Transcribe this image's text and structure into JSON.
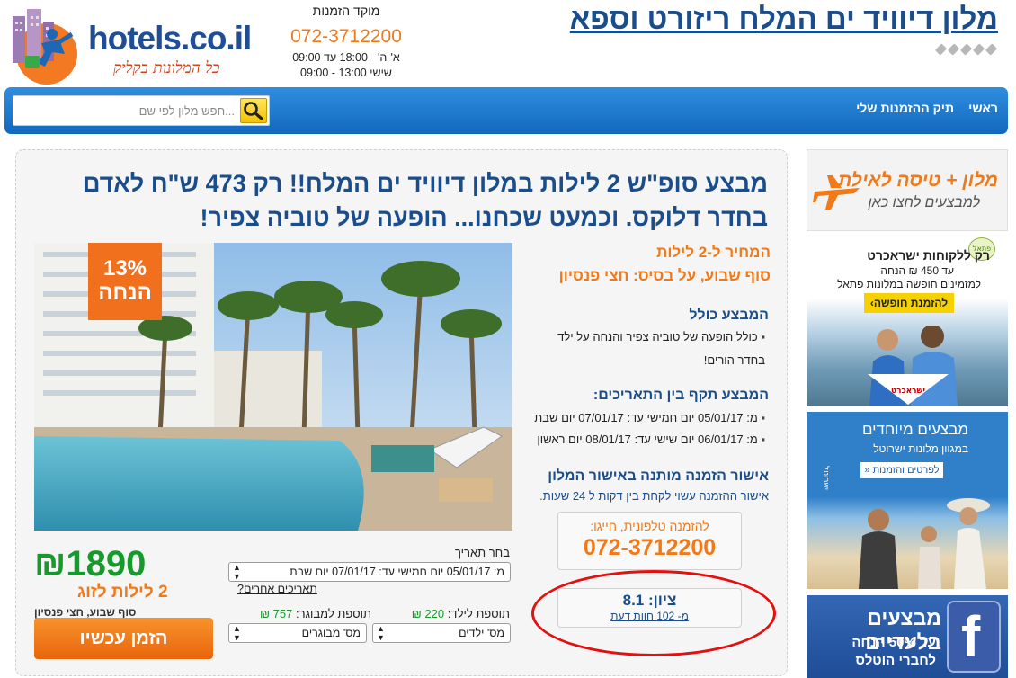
{
  "header": {
    "logo_text": "hotels.co.il",
    "logo_tagline": "כל המלונות בקליק",
    "call_center_title": "מוקד הזמנות",
    "call_center_phone": "072-3712200",
    "hours_weekdays": "א'-ה' - 18:00 עד 09:00",
    "hours_friday": "שישי 13:00 - 09:00",
    "hotel_title": "מלון דיוויד ים המלח ריזורט וספא",
    "star_count": 5
  },
  "nav": {
    "home": "ראשי",
    "my_bookings": "תיק ההזמנות שלי",
    "search_placeholder": "...חפש מלון לפי שם"
  },
  "deal": {
    "title": "מבצע סופ\"ש 2 לילות במלון דיוויד ים המלח!! רק 473 ש\"ח לאדם בחדר דלוקס. וכמעט שכחנו... הופעה של טוביה צפיר!",
    "discount_percent": "13%",
    "discount_word": "הנחה",
    "price_nights": "המחיר ל-2 לילות",
    "price_basis": "סוף שבוע, על בסיס: חצי פנסיון",
    "includes_heading": "המבצע כולל",
    "includes_items": [
      "כולל הופעה של טוביה צפיר והנחה על ילד בחדר הורים!"
    ],
    "valid_heading": "המבצע תקף בין התאריכים:",
    "valid_items": [
      "מ: 05/01/17 יום חמישי עד: 07/01/17 יום שבת",
      "מ: 06/01/17 יום שישי עד: 08/01/17 יום ראשון"
    ],
    "approval_heading": "אישור הזמנה מותנה באישור המלון",
    "approval_text": "אישור ההזמנה עשוי לקחת בין דקות ל 24 שעות.",
    "phone_label": "להזמנה טלפונית, חייגו:",
    "phone_number": "072-3712200",
    "score_label": "ציון: 8.1",
    "score_reviews": "מ- 102 חוות דעת",
    "price": "1890",
    "currency": "₪",
    "price_couple": "2 לילות לזוג",
    "price_note": "סוף שבוע, חצי פנסיון",
    "book_button": "הזמן עכשיו",
    "date_label": "בחר תאריך",
    "date_selected": "מ: 05/01/17 יום חמישי עד: 07/01/17 יום שבת",
    "other_dates": "תאריכים אחרים?",
    "child_label": "תוספת לילד:",
    "child_price": "220 ₪",
    "adult_label": "תוספת למבוגר:",
    "adult_price": "757 ₪",
    "children_select": "מס' ילדים",
    "adults_select": "מס' מבוגרים"
  },
  "sidebar": {
    "ad1_title": "מלון + טיסה לאילת",
    "ad1_sub": "למבצעים לחצו כאן",
    "ad2_title": "רק ללקוחות ישראכרט",
    "ad2_sub1": "עד 450 ₪ הנחה",
    "ad2_sub2": "למזמינים חופשה במלונות פתאל",
    "ad2_button": "להזמנת חופשה›",
    "ad2_brand": "ישראכרט",
    "ad2_fattal": "פתאל",
    "ad3_title": "מבצעים מיוחדים",
    "ad3_sub": "במגוון מלונות ישרוטל",
    "ad3_button": "לפרטים והזמנות «",
    "ad3_brand": "ישרוטל",
    "ad4_title": "מבצעים בלעדיים",
    "ad4_sub1": "עד 50% הנחה",
    "ad4_sub2": "לחברי הוטלס"
  },
  "colors": {
    "brand_blue": "#1a4d8c",
    "accent_orange": "#f07a1a",
    "price_green": "#169a2c",
    "nav_blue": "#1f78cf"
  }
}
